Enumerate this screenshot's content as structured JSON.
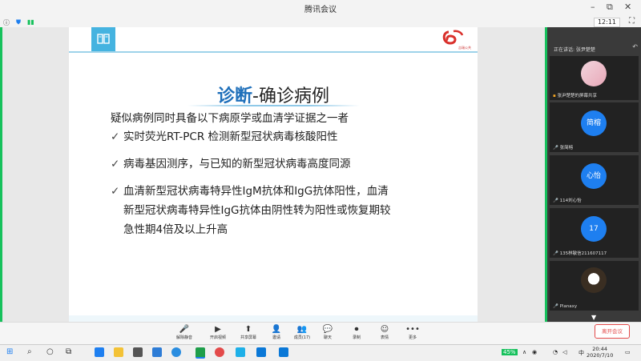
{
  "window": {
    "title": "腾讯会议",
    "minimize": "–",
    "restore": "⧉",
    "close": "✕"
  },
  "status": {
    "time": "12:11",
    "fullscreen": "⛶"
  },
  "slide": {
    "title_highlight": "诊断",
    "title_rest": "-确诊病例",
    "intro": "疑似病例同时具备以下病原学或血清学证据之一者",
    "check": "✓",
    "bullets": [
      "实时荧光RT-PCR 检测新型冠状病毒核酸阳性",
      "病毒基因测序，与已知的新型冠状病毒高度同源",
      "血清新型冠状病毒特异性IgM抗体和IgG抗体阳性，血清",
      "新型冠状病毒特异性IgG抗体由阴性转为阳性或恢复期较",
      "急性期4倍及以上升高"
    ],
    "logo_text": "吉瑞公共"
  },
  "sidebar": {
    "speaking": "正在讲话: 张尹楚楚",
    "participants": [
      {
        "name": "张尹楚楚的屏幕共享",
        "avatar": ""
      },
      {
        "name": "张简榕",
        "avatar": "简榕"
      },
      {
        "name": "114刘心怡",
        "avatar": "心怡"
      },
      {
        "name": "135林敏信211607117",
        "avatar": "17"
      },
      {
        "name": "Planaxy",
        "avatar": ""
      }
    ]
  },
  "toolbar": {
    "items": [
      {
        "icon": "🎤",
        "label": "解除静音"
      },
      {
        "icon": "▶",
        "label": "开启视频"
      },
      {
        "icon": "⬆",
        "label": "共享屏幕"
      },
      {
        "icon": "👤",
        "label": "邀请"
      },
      {
        "icon": "👥",
        "label": "成员(17)"
      },
      {
        "icon": "💬",
        "label": "聊天"
      },
      {
        "icon": "⏺",
        "label": "录制"
      },
      {
        "icon": "☺",
        "label": "表情"
      },
      {
        "icon": "•••",
        "label": "更多"
      }
    ],
    "leave": "离开会议"
  },
  "taskbar": {
    "battery": "45%",
    "ime": "中",
    "clock_time": "20:44",
    "clock_date": "2020/7/10"
  }
}
